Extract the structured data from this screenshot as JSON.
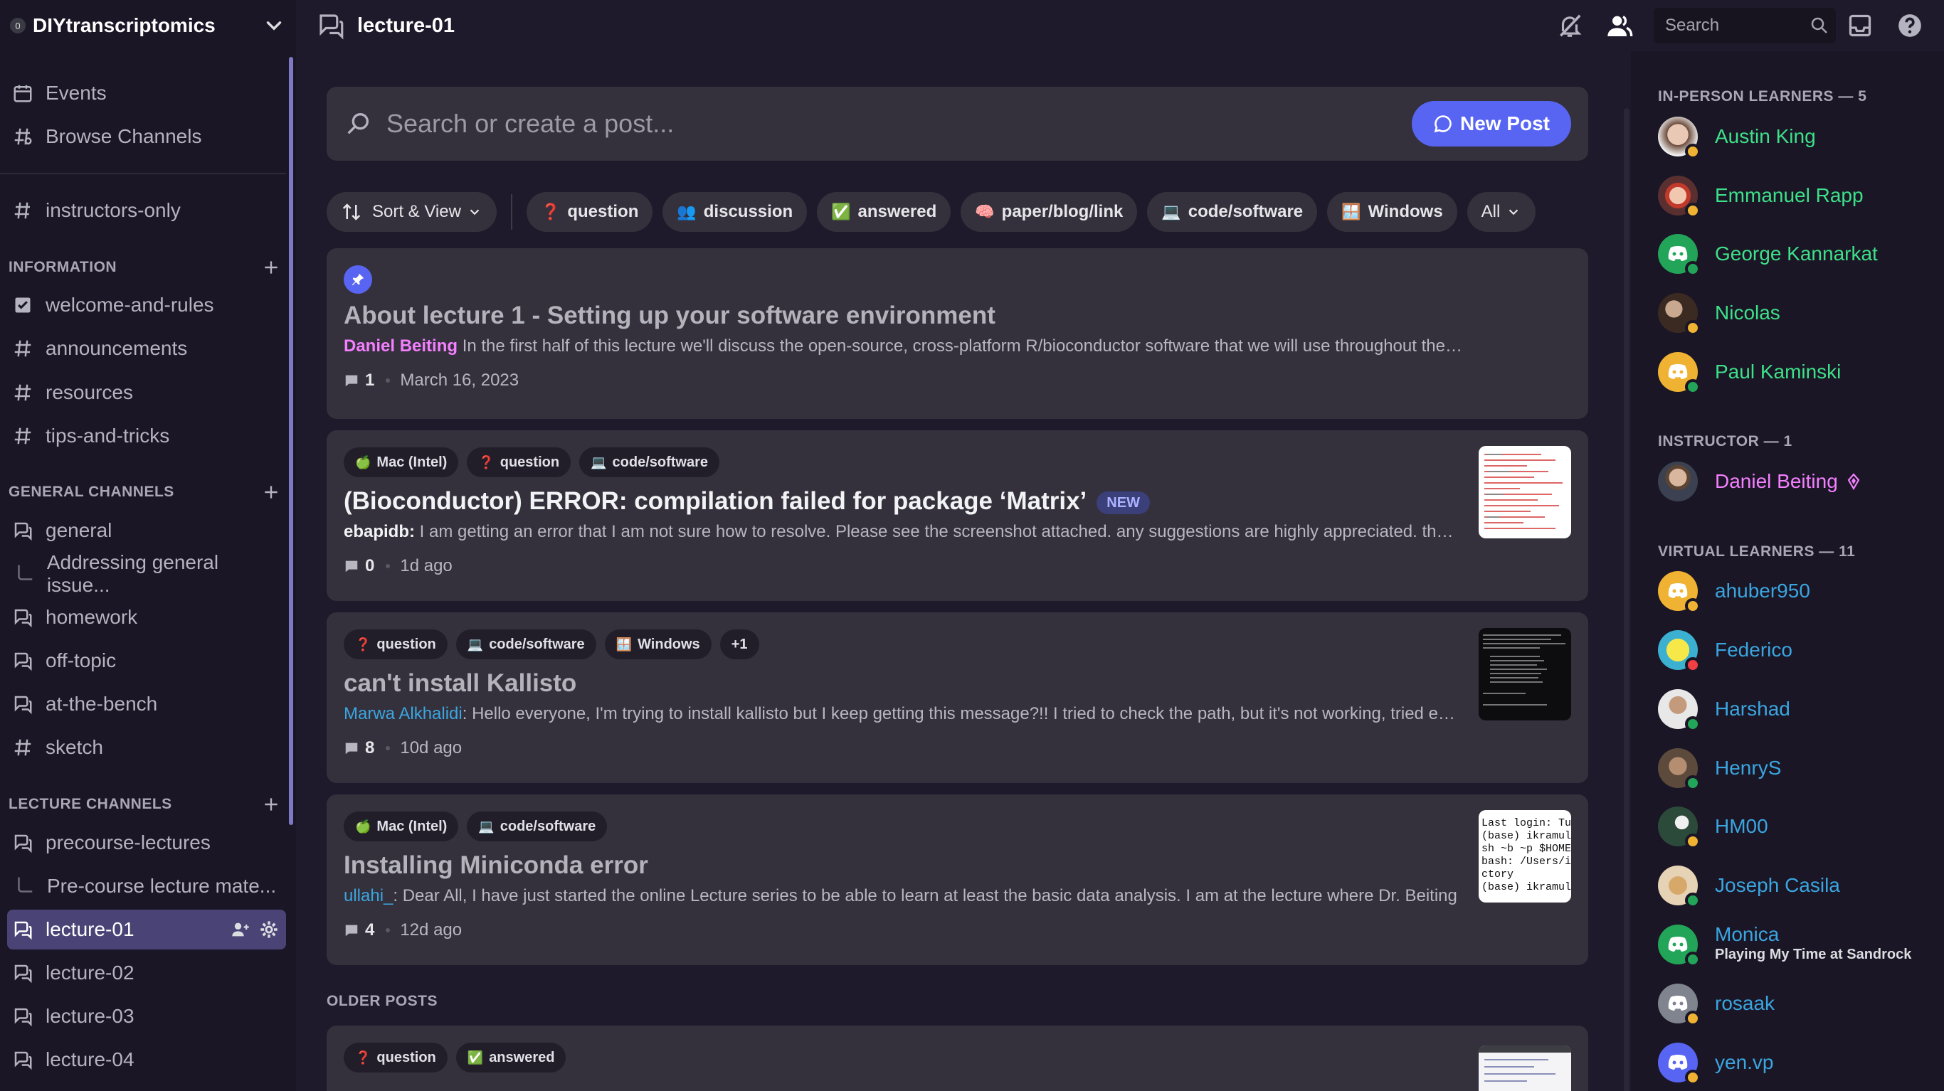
{
  "server": {
    "name": "DIYtranscriptomics",
    "icon_label": "0"
  },
  "sidebar": {
    "top_items": [
      {
        "label": "Events",
        "icon": "calendar-icon"
      },
      {
        "label": "Browse Channels",
        "icon": "browse-channels-icon"
      }
    ],
    "instructors_only": "instructors-only",
    "categories": {
      "information": "INFORMATION",
      "general": "GENERAL CHANNELS",
      "lecture": "LECTURE CHANNELS"
    },
    "information_channels": [
      "welcome-and-rules",
      "announcements",
      "resources",
      "tips-and-tricks"
    ],
    "general_channels": [
      "general",
      "Addressing general issue...",
      "homework",
      "off-topic",
      "at-the-bench",
      "sketch"
    ],
    "lecture_channels": [
      "precourse-lectures",
      "Pre-course lecture mate...",
      "lecture-01",
      "lecture-02",
      "lecture-03",
      "lecture-04"
    ]
  },
  "topbar": {
    "channel": "lecture-01",
    "search_placeholder": "Search"
  },
  "forum": {
    "search_placeholder": "Search or create a post...",
    "new_post_label": "New Post",
    "sort_label": "Sort & View",
    "filters": [
      {
        "emoji": "❓",
        "label": "question"
      },
      {
        "emoji": "👥",
        "label": "discussion"
      },
      {
        "emoji": "✅",
        "label": "answered"
      },
      {
        "emoji": "🧠",
        "label": "paper/blog/link"
      },
      {
        "emoji": "💻",
        "label": "code/software"
      },
      {
        "emoji": "🪟",
        "label": "Windows"
      }
    ],
    "all_label": "All",
    "older_posts_label": "OLDER POSTS",
    "posts": [
      {
        "title": "About lecture 1 - Setting up your software environment",
        "author": "Daniel Beiting",
        "author_color": "#f47fff",
        "snippet": " In the first half of this lecture we'll discuss the open-source, cross-platform R/bioconductor software that we will use throughout the course. In the second half of this lecture",
        "comments": "1",
        "time": "March 16, 2023"
      },
      {
        "tags": [
          {
            "emoji": "🍏",
            "label": "Mac (Intel)"
          },
          {
            "emoji": "❓",
            "label": "question"
          },
          {
            "emoji": "💻",
            "label": "code/software"
          }
        ],
        "title": "(Bioconductor) ERROR: compilation failed for package ‘Matrix’",
        "badge": "NEW",
        "author": "ebapidb:",
        "author_color": "#f2f3f5",
        "snippet": " I am getting an error that I am not sure how to resolve. Please see the screenshot attached. any suggestions are highly appreciated. thanks",
        "comments": "0",
        "time": "1d ago"
      },
      {
        "tags": [
          {
            "emoji": "❓",
            "label": "question"
          },
          {
            "emoji": "💻",
            "label": "code/software"
          },
          {
            "emoji": "🪟",
            "label": "Windows"
          },
          {
            "emoji": "",
            "label": "+1"
          }
        ],
        "title": "can't install Kallisto",
        "author": "Marwa Alkhalidi",
        "author_color": "#3ba5e0",
        "snippet": ": Hello everyone, I'm trying to install kallisto but I keep getting this message?!! I tried to check the path, but it's not working, tried everything",
        "comments": "8",
        "time": "10d ago"
      },
      {
        "tags": [
          {
            "emoji": "🍏",
            "label": "Mac (Intel)"
          },
          {
            "emoji": "💻",
            "label": "code/software"
          }
        ],
        "title": "Installing Miniconda error",
        "author": "ullahi_",
        "author_color": "#3ba5e0",
        "snippet": ": Dear All, I have just started the online Lecture series to be able to learn at least the basic data analysis. I am at the lecture where Dr. Beiting",
        "comments": "4",
        "time": "12d ago",
        "thumb_text": [
          "Last login: Tu",
          "(base) ikramul",
          "sh ~b ~p $HOME",
          "bash: /Users/i",
          "ctory",
          "(base) ikramul"
        ]
      },
      {
        "tags": [
          {
            "emoji": "❓",
            "label": "question"
          },
          {
            "emoji": "✅",
            "label": "answered"
          }
        ]
      }
    ]
  },
  "members": {
    "groups": [
      {
        "label": "IN-PERSON LEARNERS — 5",
        "color": "#3ee089",
        "people": [
          {
            "name": "Austin King",
            "status": "idle"
          },
          {
            "name": "Emmanuel Rapp",
            "status": "idle"
          },
          {
            "name": "George Kannarkat",
            "status": "online"
          },
          {
            "name": "Nicolas",
            "status": "idle"
          },
          {
            "name": "Paul Kaminski",
            "status": "online"
          }
        ]
      },
      {
        "label": "INSTRUCTOR — 1",
        "color": "#f47fff",
        "people": [
          {
            "name": "Daniel Beiting",
            "status": "none"
          }
        ]
      },
      {
        "label": "VIRTUAL LEARNERS — 11",
        "color": "#3ba5e0",
        "people": [
          {
            "name": "ahuber950",
            "status": "idle"
          },
          {
            "name": "Federico",
            "status": "dnd"
          },
          {
            "name": "Harshad",
            "status": "online"
          },
          {
            "name": "HenryS",
            "status": "online"
          },
          {
            "name": "HM00",
            "status": "idle"
          },
          {
            "name": "Joseph Casila",
            "status": "online"
          },
          {
            "name": "Monica",
            "status": "online",
            "activity": "Playing My Time at Sandrock"
          },
          {
            "name": "rosaak",
            "status": "idle"
          },
          {
            "name": "yen.vp",
            "status": "idle"
          }
        ]
      }
    ]
  }
}
